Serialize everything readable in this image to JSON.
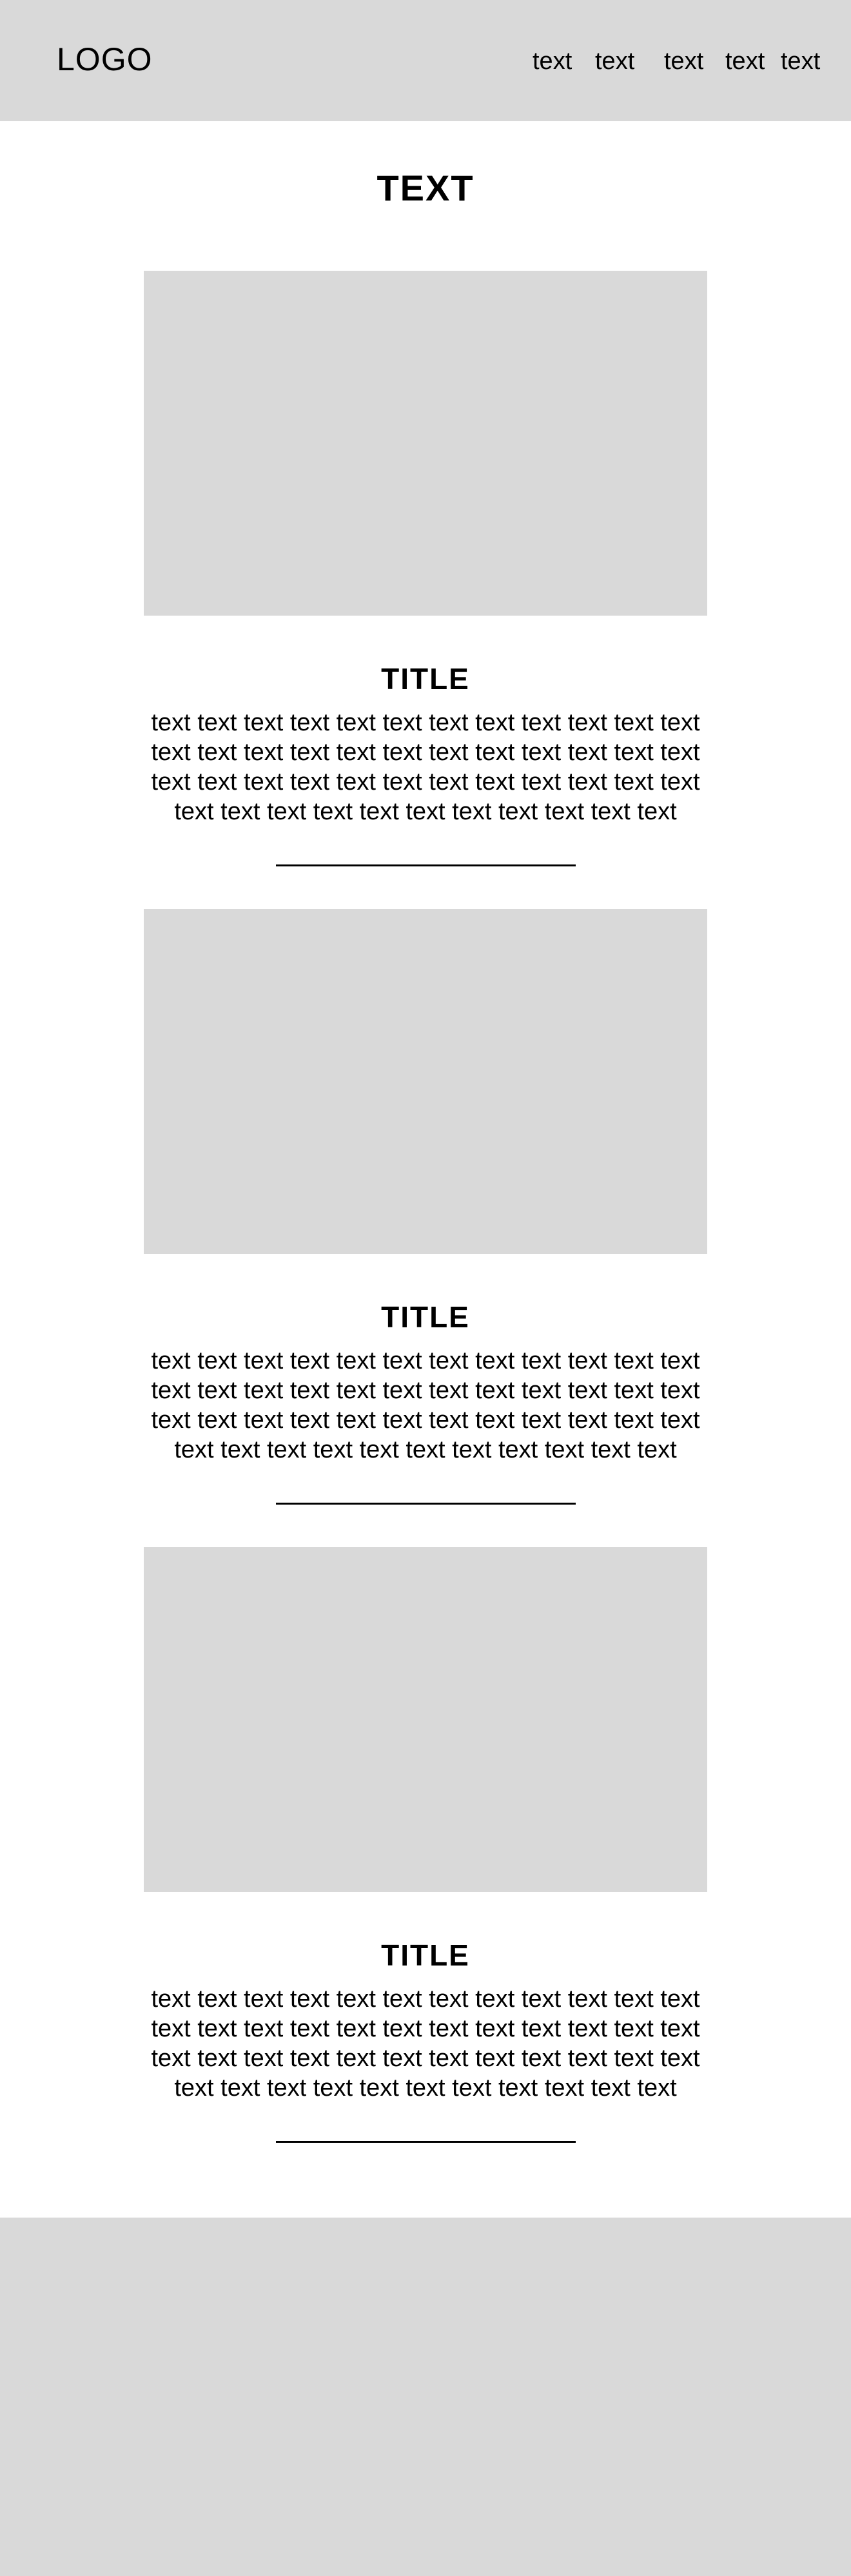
{
  "header": {
    "logo": "LOGO",
    "nav": [
      "text",
      "text",
      "text",
      "text",
      "text"
    ]
  },
  "page_title": "TEXT",
  "sections": [
    {
      "title": "TITLE",
      "body": "text text text text text text text text text text text text text text text text text text text text text text text text text text text text text text text text text text text text text text text text text text text text text text text"
    },
    {
      "title": "TITLE",
      "body": "text text text text text text text text text text text text text text text text text text text text text text text text text text text text text text text text text text text text text text text text text text text text text text text"
    },
    {
      "title": "TITLE",
      "body": "text text text text text text text text text text text text text text text text text text text text text text text text text text text text text text text text text text text text text text text text text text text text text text text"
    }
  ]
}
